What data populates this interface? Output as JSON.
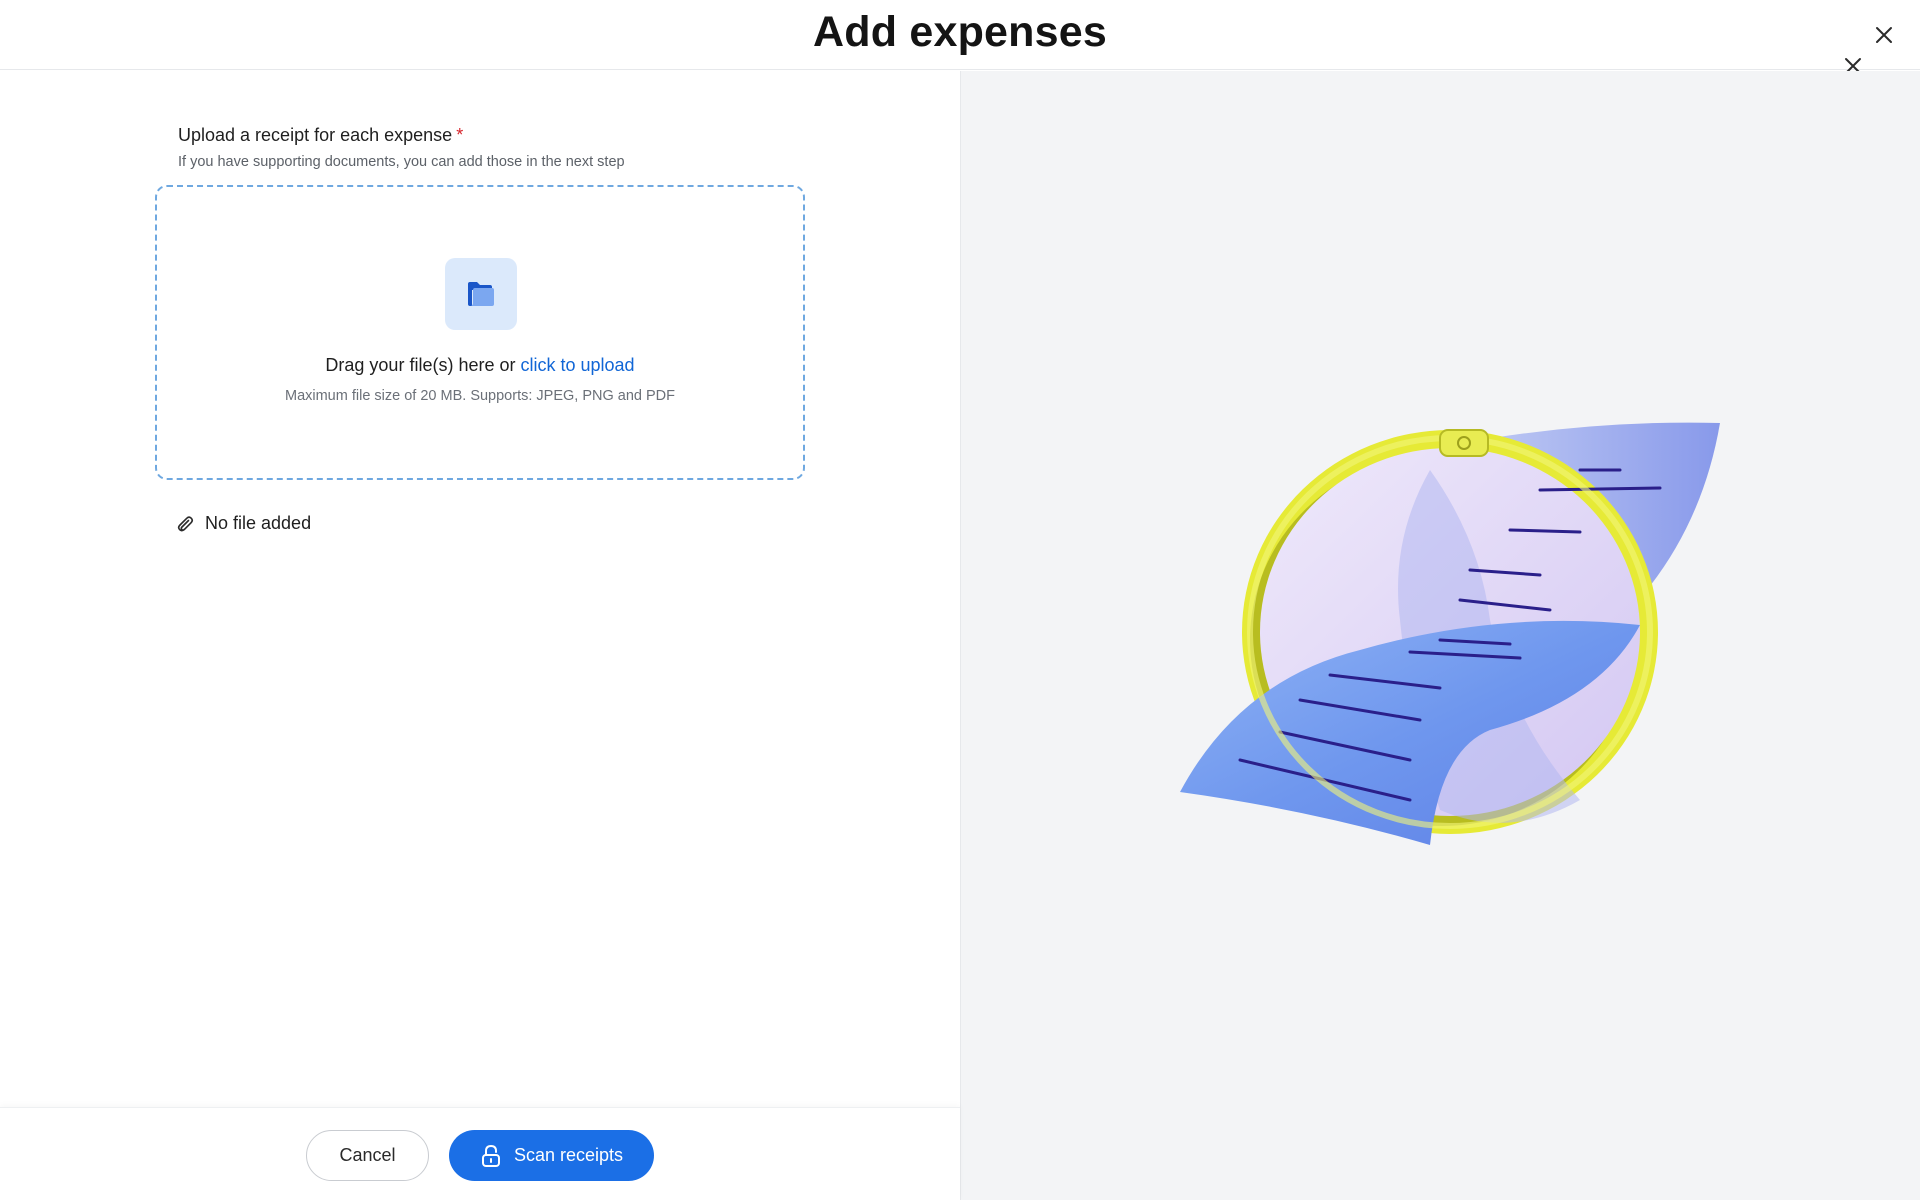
{
  "header": {
    "title": "Add expenses"
  },
  "upload": {
    "label": "Upload a receipt for each expense",
    "required_marker": "*",
    "hint": "If you have supporting documents, you can add those in the next step",
    "drop_text": "Drag your file(s) here or",
    "drop_link": "click to upload",
    "limits": "Maximum file size of 20 MB. Supports: JPEG, PNG and PDF",
    "status": "No file added"
  },
  "footer": {
    "cancel_label": "Cancel",
    "scan_label": "Scan receipts"
  },
  "icons": {
    "close": "close-icon",
    "folder": "folder-icon",
    "paperclip": "paperclip-icon",
    "lock": "lock-icon"
  },
  "colors": {
    "accent": "#1b6fe6",
    "link": "#1166d6",
    "required": "#d6232a",
    "dropzone_border": "#6fa8e0",
    "illustration_panel": "#f3f4f6"
  }
}
